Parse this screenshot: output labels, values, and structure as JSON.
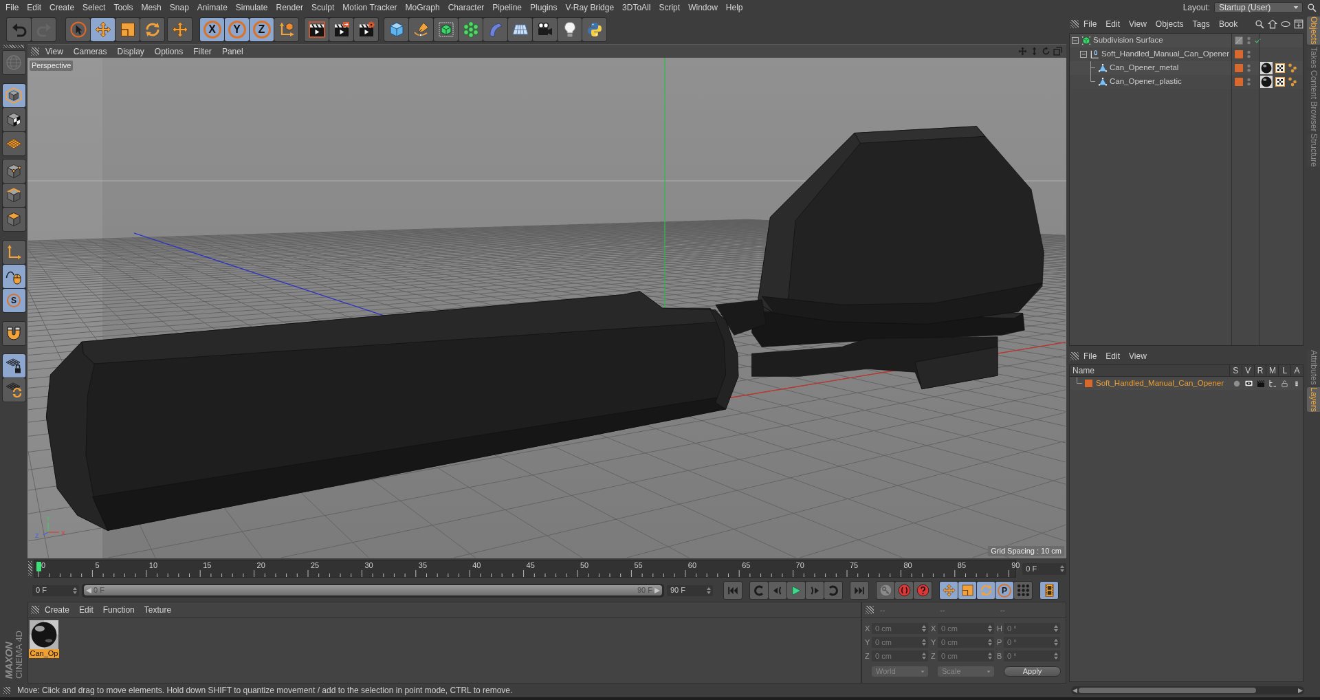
{
  "menu_bar": {
    "items": [
      "File",
      "Edit",
      "Create",
      "Select",
      "Tools",
      "Mesh",
      "Snap",
      "Animate",
      "Simulate",
      "Render",
      "Sculpt",
      "Motion Tracker",
      "MoGraph",
      "Character",
      "Pipeline",
      "Plugins",
      "V-Ray Bridge",
      "3DToAll",
      "Script",
      "Window",
      "Help"
    ],
    "layout": {
      "label": "Layout:",
      "value": "Startup (User)"
    }
  },
  "toolbar": {
    "groups": [
      [
        {
          "selected": false,
          "disabled": false
        },
        {
          "selected": false,
          "disabled": true
        }
      ],
      [
        {
          "selected": false
        },
        {
          "selected": true
        },
        {
          "selected": false
        },
        {
          "selected": false
        }
      ],
      [
        {
          "selected": false
        }
      ],
      [
        {
          "label": "X",
          "selected": true
        },
        {
          "label": "Y",
          "selected": true
        },
        {
          "label": "Z",
          "selected": true
        },
        {
          "selected": false
        }
      ],
      [
        {
          "selected": false
        },
        {
          "selected": false
        },
        {
          "selected": false
        }
      ],
      [
        {
          "selected": false
        },
        {
          "selected": false
        },
        {
          "selected": false
        },
        {
          "selected": false
        },
        {
          "selected": false
        },
        {
          "selected": false
        },
        {
          "selected": false
        },
        {
          "selected": false
        },
        {
          "selected": false
        }
      ]
    ]
  },
  "mode_palette": {
    "groups": [
      [
        {
          "selected": false,
          "disabled": true
        }
      ],
      [
        {
          "selected": true
        },
        {
          "selected": false
        },
        {
          "selected": false
        }
      ],
      [
        {
          "selected": false
        },
        {
          "selected": false
        },
        {
          "selected": false
        }
      ],
      [
        {
          "selected": false
        },
        {
          "selected": true
        },
        {
          "label": "S",
          "selected": true
        }
      ],
      [
        {
          "selected": false
        }
      ],
      [
        {
          "selected": true
        },
        {
          "selected": false
        }
      ]
    ]
  },
  "viewport": {
    "menu": [
      "View",
      "Cameras",
      "Display",
      "Options",
      "Filter",
      "Panel"
    ],
    "camera": "Perspective",
    "grid_spacing": "Grid Spacing : 10 cm",
    "axis_labels": [
      "Y",
      "Z",
      "X"
    ]
  },
  "timeline": {
    "ticks": [
      "0",
      "5",
      "10",
      "15",
      "20",
      "25",
      "30",
      "35",
      "40",
      "45",
      "50",
      "55",
      "60",
      "65",
      "70",
      "75",
      "80",
      "85",
      "90"
    ],
    "playhead": {
      "level": 0
    },
    "current_frame": "0 F",
    "start_frame": "0 F",
    "range_bar": {
      "level": 1
    },
    "range_start": "0 F",
    "range_end": "90 F",
    "end_frame": "90 F"
  },
  "transport": {
    "mode_buttons": [
      {
        "selected": true
      },
      {
        "selected": true
      },
      {
        "selected": true
      },
      {
        "label": "P",
        "selected": true
      },
      {
        "selected": false
      }
    ],
    "timeline_button": {
      "selected": true
    }
  },
  "material_manager": {
    "menu": [
      "Create",
      "Edit",
      "Function",
      "Texture"
    ],
    "materials": [
      {
        "name": "Can_Op",
        "selected": true
      }
    ]
  },
  "coordinates": {
    "headers": [
      "--",
      "--",
      "--"
    ],
    "rows": [
      {
        "position_axis": "X",
        "position": "0 cm",
        "size_axis": "X",
        "size": "0 cm",
        "rotation_axis": "H",
        "rotation": "0 °"
      },
      {
        "position_axis": "Y",
        "position": "0 cm",
        "size_axis": "Y",
        "size": "0 cm",
        "rotation_axis": "P",
        "rotation": "0 °"
      },
      {
        "position_axis": "Z",
        "position": "0 cm",
        "size_axis": "Z",
        "size": "0 cm",
        "rotation_axis": "B",
        "rotation": "0 °"
      }
    ],
    "dropdowns": [
      "World",
      "Scale"
    ],
    "apply_button": "Apply"
  },
  "logo": {
    "brand": "MAXON",
    "product": "CINEMA 4D"
  },
  "status_bar": {
    "text": "Move: Click and drag to move elements. Hold down SHIFT to quantize movement / add to the selection in point mode, CTRL to remove."
  },
  "object_manager": {
    "menu": [
      "File",
      "Edit",
      "View",
      "Objects",
      "Tags",
      "Book"
    ],
    "tree": [
      {
        "name": "Subdivision Surface",
        "kind": "generator",
        "expanded": true,
        "enabled": true,
        "has_tags": false,
        "children": [
          {
            "name": "Soft_Handled_Manual_Can_Opener",
            "kind": "null",
            "expanded": true,
            "color": "#d8682c",
            "enabled": false,
            "has_tags": false,
            "children": [
              {
                "name": "Can_Opener_metal",
                "kind": "polygon",
                "color": "#d8682c",
                "enabled": false,
                "has_tags": true
              },
              {
                "name": "Can_Opener_plastic",
                "kind": "polygon",
                "color": "#d8682c",
                "enabled": false,
                "has_tags": true
              }
            ]
          }
        ]
      }
    ]
  },
  "side_tabs": {
    "upper": [
      {
        "label": "Objects",
        "selected": true
      },
      {
        "label": "Takes",
        "selected": false
      },
      {
        "label": "Content Browser",
        "selected": false
      },
      {
        "label": "Structure",
        "selected": false
      }
    ],
    "lower": [
      {
        "label": "Attributes",
        "selected": false
      },
      {
        "label": "Layers",
        "selected": true
      }
    ]
  },
  "layers": {
    "menu": [
      "File",
      "Edit",
      "View"
    ],
    "columns": [
      "Name",
      "S",
      "V",
      "R",
      "M",
      "L",
      "A"
    ],
    "items": [
      {
        "name": "Soft_Handled_Manual_Can_Opener",
        "color": "#d8682c"
      }
    ]
  }
}
